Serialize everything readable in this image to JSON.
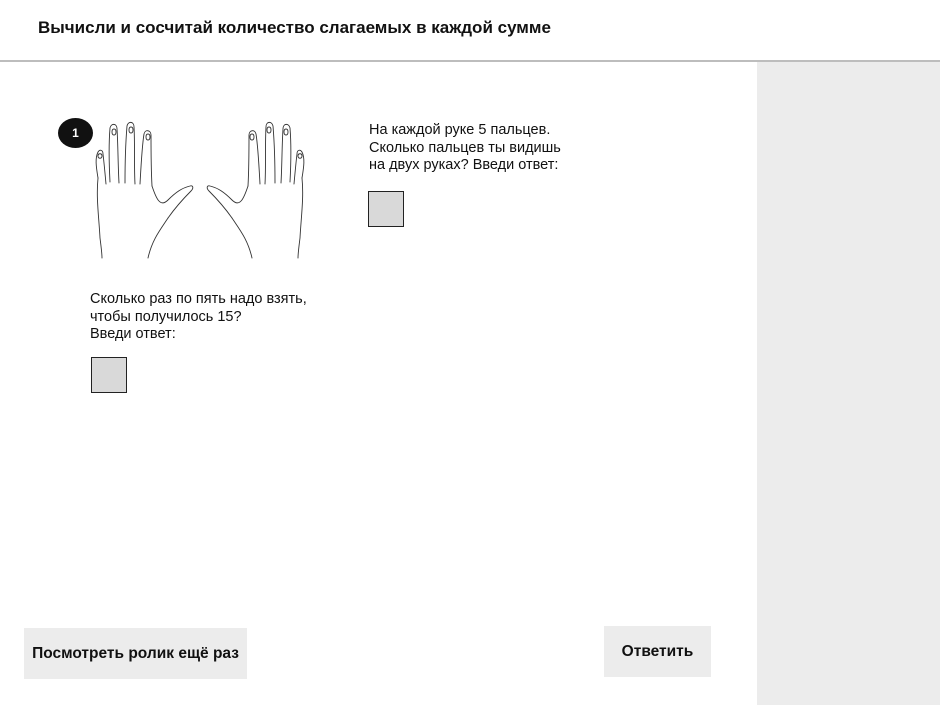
{
  "header": {
    "title": "Вычисли и сосчитай количество слагаемых в каждой сумме"
  },
  "task": {
    "number": "1",
    "image_icon": "two-hands-icon",
    "question_1": {
      "lines": [
        "На каждой руке 5 пальцев.",
        "Сколько пальцев ты видишь",
        "на двух руках? Введи ответ:"
      ],
      "answer_value": ""
    },
    "question_2": {
      "lines": [
        "Сколько раз по пять надо взять,",
        "чтобы получилось 15?",
        "Введи ответ:"
      ],
      "answer_value": ""
    }
  },
  "footer": {
    "replay_label": "Посмотреть ролик ещё раз",
    "answer_label": "Ответить"
  },
  "colors": {
    "badge": "#111111",
    "input_bg": "#d9d9d9",
    "button_bg": "#ececec",
    "sidebar_bg": "#ececec",
    "header_border": "#bdbdbd"
  }
}
